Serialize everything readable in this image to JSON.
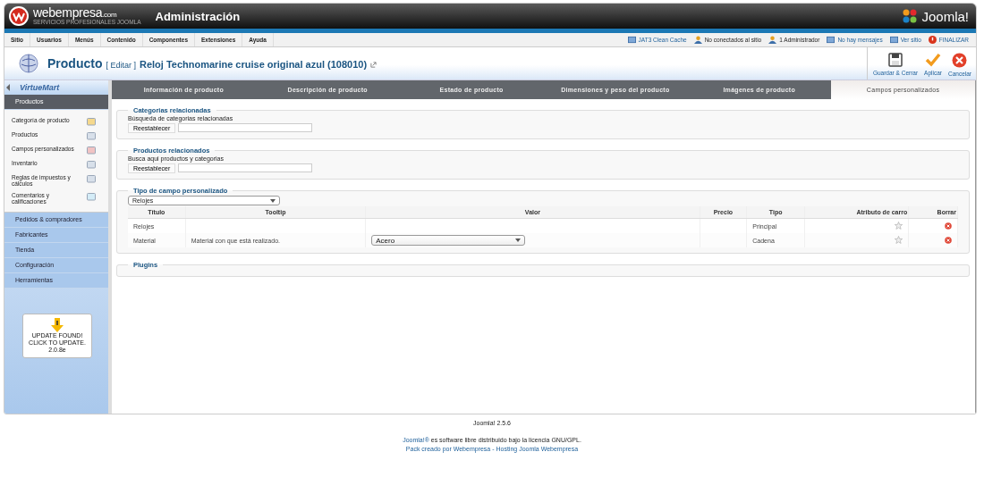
{
  "header": {
    "brand": "webempresa",
    "brand_suffix": ".com",
    "brand_tagline": "SERVICIOS PROFESIONALES JOOMLA",
    "title": "Administración",
    "cms_logo": "Joomla!"
  },
  "menu": [
    "Sitio",
    "Usuarios",
    "Menús",
    "Contenido",
    "Componentes",
    "Extensiones",
    "Ayuda"
  ],
  "status": [
    {
      "label": "JAT3 Clean Cache",
      "kind": "link"
    },
    {
      "label": "No conectados al sitio",
      "kind": "text"
    },
    {
      "label": "1 Administrador",
      "kind": "text"
    },
    {
      "label": "No hay mensajes",
      "kind": "link"
    },
    {
      "label": "Ver sitio",
      "kind": "link"
    },
    {
      "label": "FINALIZAR",
      "kind": "logout"
    }
  ],
  "page_title": {
    "section": "Producto",
    "action": "[ Editar ]",
    "item": "Reloj Technomarine cruise original azul (108010)"
  },
  "toolbar": [
    {
      "label": "Guardar & Cerrar",
      "kind": "save"
    },
    {
      "label": "Aplicar",
      "kind": "apply"
    },
    {
      "label": "Cancelar",
      "kind": "cancel"
    }
  ],
  "sidebar": {
    "logo": "VirtueMart",
    "groups": [
      {
        "label": "Productos",
        "expanded": true,
        "items": [
          "Categoría de producto",
          "Productos",
          "Campos personalizados",
          "Inventario",
          "Reglas de impuestos y cálculos",
          "Comentarios y calificaciones"
        ]
      },
      {
        "label": "Pedidos & compradores",
        "expanded": false
      },
      {
        "label": "Fabricantes",
        "expanded": false
      },
      {
        "label": "Tienda",
        "expanded": false
      },
      {
        "label": "Configuración",
        "expanded": false
      },
      {
        "label": "Herramientas",
        "expanded": false
      }
    ],
    "update": {
      "lines": [
        "UPDATE FOUND!",
        "CLICK TO UPDATE.",
        "2.0.8e"
      ]
    }
  },
  "tabs": [
    {
      "label": "Información de producto",
      "selected": false
    },
    {
      "label": "Descripción de producto",
      "selected": false
    },
    {
      "label": "Estado de producto",
      "selected": false
    },
    {
      "label": "Dimensiones y peso del producto",
      "selected": false
    },
    {
      "label": "Imágenes de producto",
      "selected": false
    },
    {
      "label": "Campos personalizados",
      "selected": true
    }
  ],
  "related_categories": {
    "title": "Categorias relacionadas",
    "hint": "Búsqueda de categorias relacionadas",
    "button": "Reestablecer"
  },
  "related_products": {
    "title": "Productos relacionados",
    "hint": "Busca aqui productos y categorias",
    "button": "Reestablecer"
  },
  "custom_fields": {
    "title": "Tipo de campo personalizado",
    "type_select": "Relojes",
    "columns": [
      "Título",
      "Tooltip",
      "Valor",
      "Precio",
      "Tipo",
      "Atributo de carro",
      "Borrar"
    ],
    "rows": [
      {
        "title": "Relojes",
        "tooltip": "",
        "value": "",
        "kind": "plain",
        "type": "Principal"
      },
      {
        "title": "Material",
        "tooltip": "Material con que está realizado.",
        "value": "Acero",
        "kind": "select",
        "type": "Cadena"
      }
    ]
  },
  "plugins": {
    "title": "Plugins"
  },
  "footer": {
    "version": "Joomla! 2.5.6",
    "license_link": "Joomla!®",
    "license_text": " es software libre distribuido bajo la licencia GNU/GPL.",
    "credits": "Pack creado por Webempresa - Hosting Joomla Webempresa"
  }
}
